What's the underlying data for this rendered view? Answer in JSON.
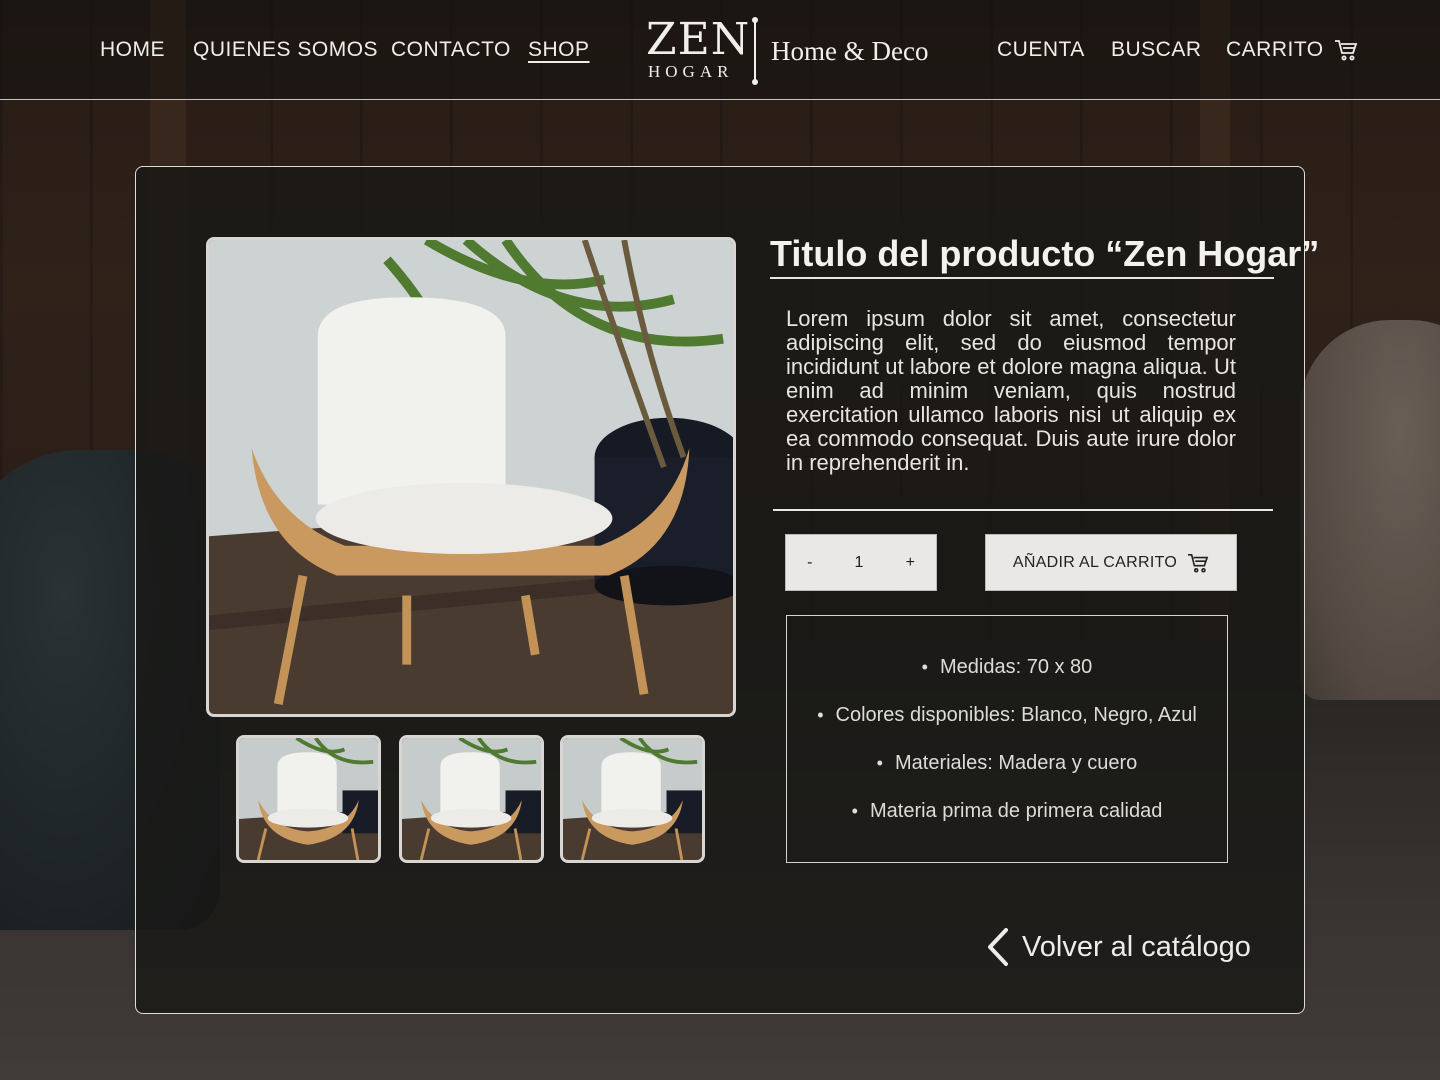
{
  "header": {
    "nav_left": [
      {
        "label": "HOME"
      },
      {
        "label": "QUIENES SOMOS"
      },
      {
        "label": "CONTACTO"
      },
      {
        "label": "SHOP",
        "active": true
      }
    ],
    "logo": {
      "main": "ZEN",
      "sub": "HOGAR",
      "tagline": "Home & Deco"
    },
    "nav_right": [
      {
        "label": "CUENTA"
      },
      {
        "label": "BUSCAR"
      },
      {
        "label": "CARRITO",
        "icon": "cart-icon"
      }
    ]
  },
  "product": {
    "title": "Titulo del producto “Zen Hogar”",
    "description": "Lorem ipsum dolor sit amet, consectetur adipiscing elit, sed do eiusmod tempor incididunt ut labore et dolore magna aliqua. Ut enim ad minim veniam, quis nostrud exercitation ullamco laboris nisi ut aliquip ex ea commodo consequat. Duis aute irure dolor in reprehenderit in.",
    "quantity": {
      "minus": "-",
      "value": "1",
      "plus": "+"
    },
    "add_to_cart_label": "AÑADIR AL CARRITO",
    "add_to_cart_icon": "cart-icon",
    "specs": [
      "Medidas: 70 x 80",
      "Colores disponibles: Blanco, Negro, Azul",
      "Materiales: Madera y cuero",
      "Materia prima de primera calidad"
    ],
    "main_image_icon": "chair-photo",
    "thumbnails": [
      "chair-photo",
      "chair-photo",
      "chair-photo"
    ]
  },
  "back_link": {
    "label": "Volver al catálogo",
    "icon": "chevron-left-icon"
  },
  "colors": {
    "button_bg": "#e9e8e6",
    "card_bg": "#191816",
    "text": "#e8e6e2"
  }
}
